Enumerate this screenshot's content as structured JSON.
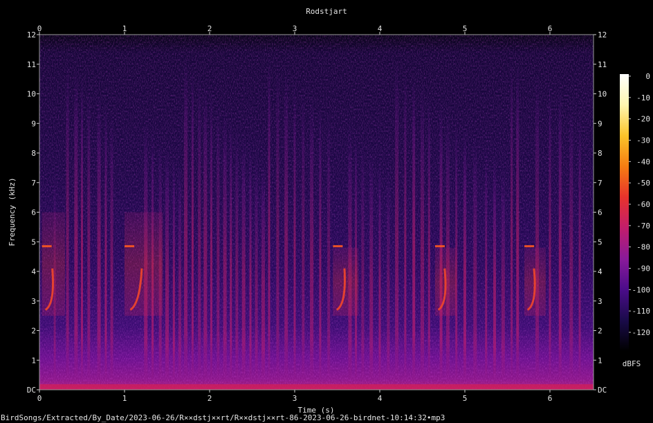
{
  "chart_data": {
    "type": "heatmap",
    "title": "Rodstjart",
    "xlabel": "Time (s)",
    "ylabel": "Frequency (kHz)",
    "xlim": [
      0,
      6.5
    ],
    "ylim": [
      0,
      12
    ],
    "x_ticks": [
      "0",
      "1",
      "2",
      "3",
      "4",
      "5",
      "6"
    ],
    "y_ticks": [
      "DC",
      "1",
      "2",
      "3",
      "4",
      "5",
      "6",
      "7",
      "8",
      "9",
      "10",
      "11",
      "12"
    ],
    "colorbar": {
      "label": "dBFS",
      "ticks": [
        "0",
        "-10",
        "-20",
        "-30",
        "-40",
        "-50",
        "-60",
        "-70",
        "-80",
        "-90",
        "-100",
        "-110",
        "-120"
      ],
      "range": [
        -120,
        0
      ],
      "colormap": [
        "#000000",
        "#1a0b4a",
        "#4b0c8a",
        "#8a1a9a",
        "#c21d6c",
        "#e8332c",
        "#f57d12",
        "#fbc42a",
        "#fff6b0",
        "#ffffff"
      ]
    },
    "song_phrases": [
      {
        "start": 0.03,
        "end": 0.3,
        "low_khz": 2.7,
        "high_khz": 5.5
      },
      {
        "start": 1.0,
        "end": 1.45,
        "low_khz": 2.7,
        "high_khz": 5.5
      },
      {
        "start": 3.45,
        "end": 3.75,
        "low_khz": 2.7,
        "high_khz": 4.3
      },
      {
        "start": 4.65,
        "end": 4.9,
        "low_khz": 2.7,
        "high_khz": 4.3
      },
      {
        "start": 5.7,
        "end": 5.95,
        "low_khz": 2.7,
        "high_khz": 4.3
      }
    ],
    "click_times": [
      0.18,
      0.33,
      0.43,
      0.5,
      0.58,
      0.7,
      0.78,
      0.85,
      1.25,
      1.33,
      1.42,
      1.5,
      1.58,
      1.65,
      1.72,
      1.8,
      1.88,
      1.95,
      2.02,
      2.1,
      2.18,
      2.25,
      2.32,
      2.4,
      2.48,
      2.55,
      2.63,
      2.7,
      2.8,
      2.9,
      3.0,
      3.1,
      3.2,
      3.3,
      3.4,
      3.65,
      3.72,
      3.8,
      3.9,
      4.0,
      4.1,
      4.2,
      4.3,
      4.4,
      4.5,
      4.58,
      4.72,
      4.8,
      4.9,
      5.0,
      5.12,
      5.25,
      5.35,
      5.45,
      5.55,
      5.62,
      5.85,
      6.0,
      6.12,
      6.25,
      6.35
    ]
  },
  "footer": {
    "path": "BirdSongs/Extracted/By_Date/2023-06-26/R××dstj××rt/R××dstj××rt-86-2023-06-26-birdnet-10:14:32•mp3"
  }
}
